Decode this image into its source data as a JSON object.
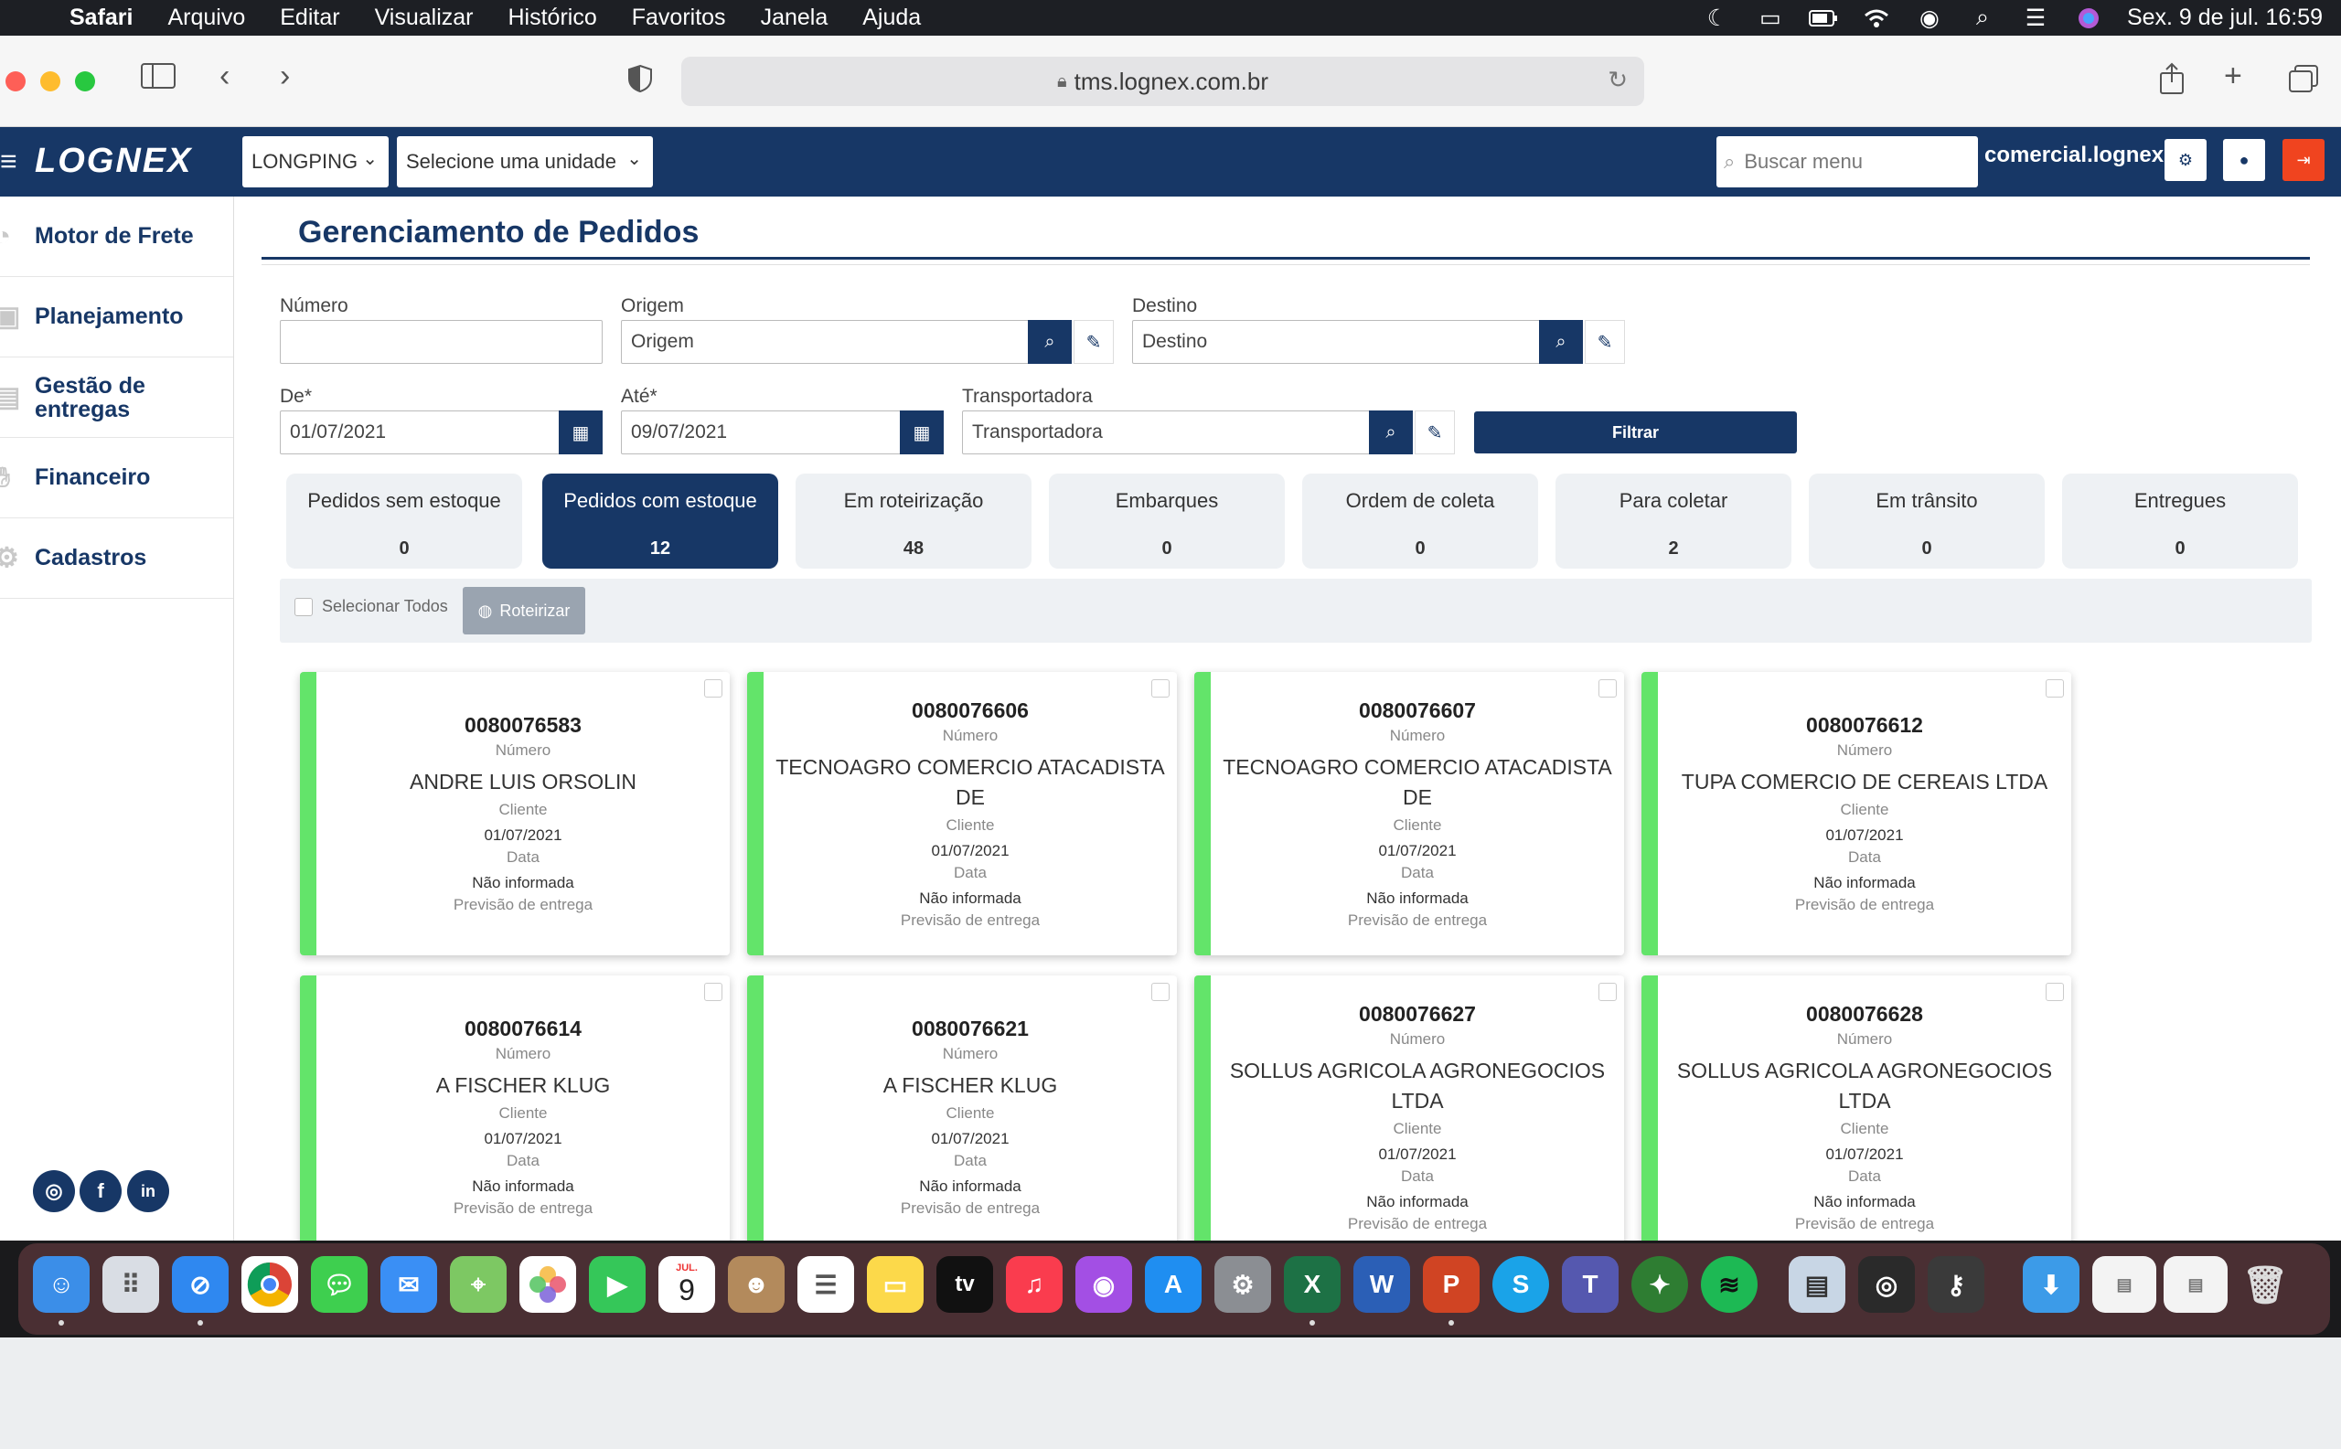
{
  "menubar": {
    "apple": "",
    "app": "Safari",
    "items": [
      "Arquivo",
      "Editar",
      "Visualizar",
      "Histórico",
      "Favoritos",
      "Janela",
      "Ajuda"
    ],
    "datetime": "Sex. 9 de jul.  16:59"
  },
  "browser": {
    "url": "tms.lognex.com.br"
  },
  "header": {
    "logo": "LOGNEX",
    "company_select": "LONGPING",
    "unit_select": "Selecione uma unidade",
    "search_placeholder": "Buscar menu",
    "user": "comercial.lognex"
  },
  "sidebar": {
    "items": [
      {
        "label": "Motor de Frete"
      },
      {
        "label": "Planejamento"
      },
      {
        "label": "Gestão de entregas"
      },
      {
        "label": "Financeiro"
      },
      {
        "label": "Cadastros"
      }
    ]
  },
  "page": {
    "title": "Gerenciamento de Pedidos"
  },
  "filters": {
    "numero_label": "Número",
    "numero_value": "",
    "origem_label": "Origem",
    "origem_placeholder": "Origem",
    "destino_label": "Destino",
    "destino_placeholder": "Destino",
    "de_label": "De*",
    "de_value": "01/07/2021",
    "ate_label": "Até*",
    "ate_value": "09/07/2021",
    "transportadora_label": "Transportadora",
    "transportadora_placeholder": "Transportadora",
    "filter_button": "Filtrar"
  },
  "tabs": [
    {
      "label": "Pedidos sem estoque",
      "count": "0",
      "active": false
    },
    {
      "label": "Pedidos com estoque",
      "count": "12",
      "active": true
    },
    {
      "label": "Em roteirização",
      "count": "48",
      "active": false
    },
    {
      "label": "Embarques",
      "count": "0",
      "active": false
    },
    {
      "label": "Ordem de coleta",
      "count": "0",
      "active": false
    },
    {
      "label": "Para coletar",
      "count": "2",
      "active": false
    },
    {
      "label": "Em trânsito",
      "count": "0",
      "active": false
    },
    {
      "label": "Entregues",
      "count": "0",
      "active": false
    }
  ],
  "selection": {
    "select_all": "Selecionar Todos",
    "route_button": "Roteirizar"
  },
  "card_labels": {
    "numero": "Número",
    "cliente": "Cliente",
    "data": "Data",
    "previsao": "Previsão de entrega"
  },
  "orders": [
    {
      "numero": "0080076583",
      "cliente": "ANDRE LUIS ORSOLIN",
      "data": "01/07/2021",
      "previsao": "Não informada"
    },
    {
      "numero": "0080076606",
      "cliente": "TECNOAGRO COMERCIO ATACADISTA DE",
      "data": "01/07/2021",
      "previsao": "Não informada"
    },
    {
      "numero": "0080076607",
      "cliente": "TECNOAGRO COMERCIO ATACADISTA DE",
      "data": "01/07/2021",
      "previsao": "Não informada"
    },
    {
      "numero": "0080076612",
      "cliente": "TUPA COMERCIO DE CEREAIS LTDA",
      "data": "01/07/2021",
      "previsao": "Não informada"
    },
    {
      "numero": "0080076614",
      "cliente": "A FISCHER KLUG",
      "data": "01/07/2021",
      "previsao": "Não informada"
    },
    {
      "numero": "0080076621",
      "cliente": "A FISCHER KLUG",
      "data": "01/07/2021",
      "previsao": "Não informada"
    },
    {
      "numero": "0080076627",
      "cliente": "SOLLUS AGRICOLA AGRONEGOCIOS LTDA",
      "data": "01/07/2021",
      "previsao": "Não informada"
    },
    {
      "numero": "0080076628",
      "cliente": "SOLLUS AGRICOLA AGRONEGOCIOS LTDA",
      "data": "01/07/2021",
      "previsao": "Não informada"
    }
  ],
  "colors": {
    "brand": "#173766",
    "status_bar": "#63e46a",
    "logout": "#f0441f"
  },
  "dock": {
    "calendar_month": "JUL.",
    "calendar_day": "9",
    "tv": "tv"
  }
}
